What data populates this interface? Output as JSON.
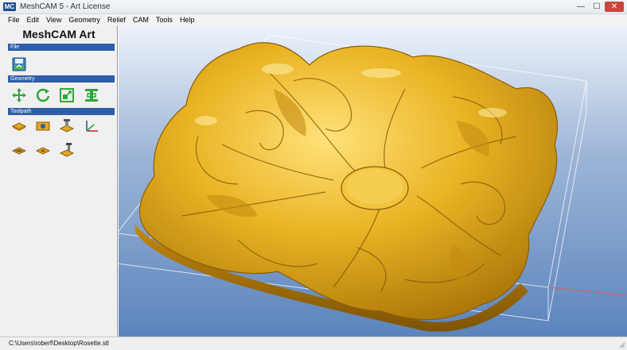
{
  "window": {
    "logo_text": "MC",
    "title": "MeshCAM 5 - Art License",
    "minimize_glyph": "—",
    "maximize_glyph": "☐",
    "close_glyph": "✕"
  },
  "menu": [
    "File",
    "Edit",
    "View",
    "Geometry",
    "Relief",
    "CAM",
    "Tools",
    "Help"
  ],
  "panel": {
    "title": "MeshCAM Art",
    "sections": {
      "file": "File",
      "geometry": "Geometry",
      "toolpath": "Toolpath"
    },
    "file_tools": [
      "open-file-icon"
    ],
    "geometry_tools": [
      "move-icon",
      "rotate-icon",
      "scale-icon",
      "align-icon"
    ],
    "toolpath_tools": [
      "stock-icon",
      "machine-region-icon",
      "define-tool-icon",
      "set-origin-icon",
      "toolpath-icon",
      "depth-icon",
      "cut-tool-icon"
    ]
  },
  "colors": {
    "accent": "#2f5da8",
    "model_gold": "#e9b21f",
    "viewport_top": "#eef3fb",
    "viewport_bottom": "#5b84bd"
  },
  "status": {
    "path": "C:\\Users\\roberf\\Desktop\\Rosette.stl"
  }
}
